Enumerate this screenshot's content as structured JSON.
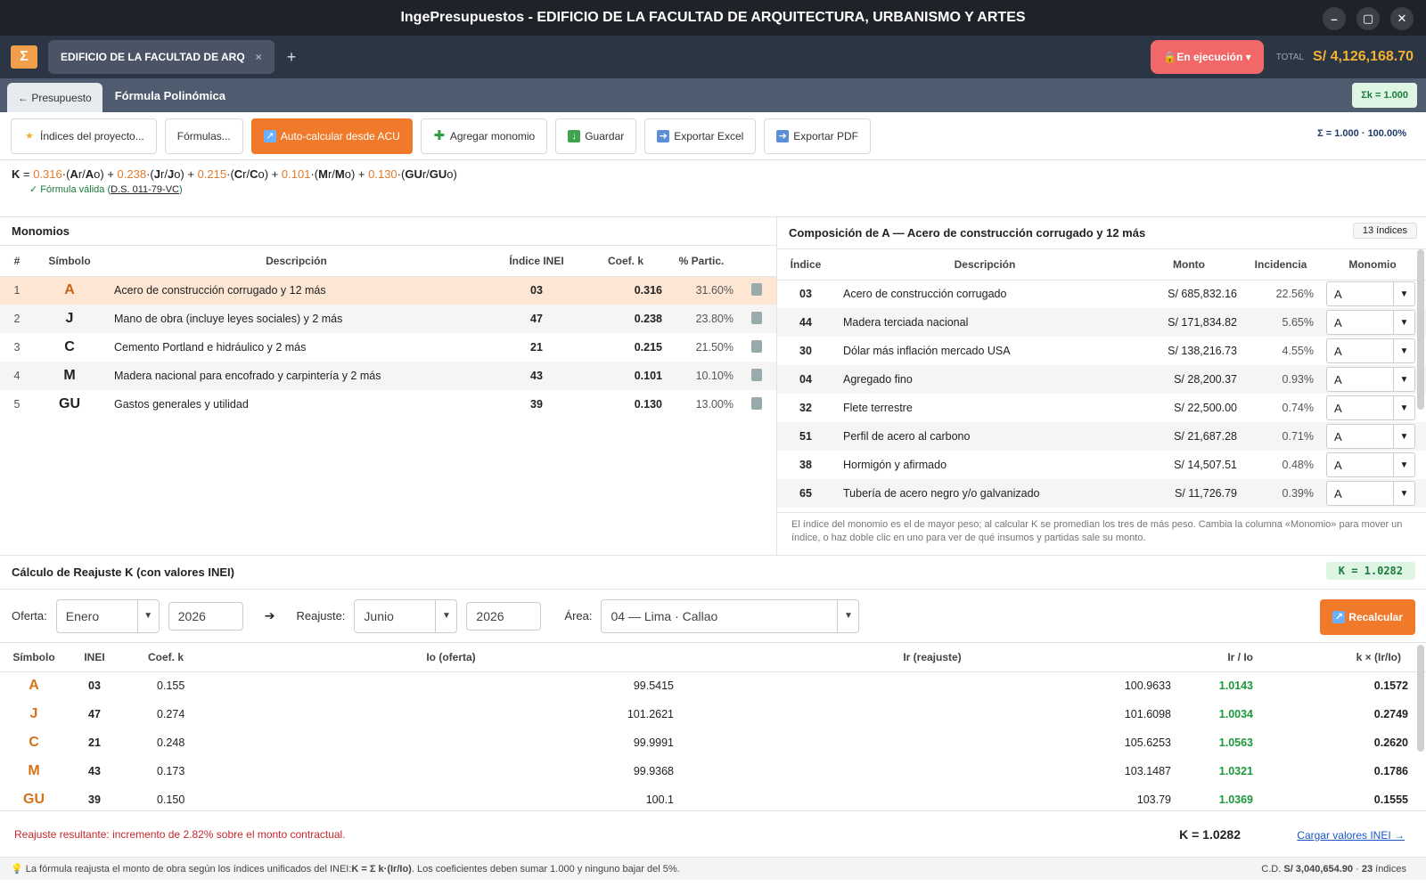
{
  "window": {
    "title": "IngePresupuestos  -  EDIFICIO DE LA FACULTAD DE ARQUITECTURA, URBANISMO Y ARTES"
  },
  "tabbar": {
    "tab_label": "EDIFICIO DE LA FACULTAD DE ARQ",
    "close": "×",
    "add": "+",
    "status": "En ejecución",
    "total_label": "TOTAL",
    "total_value": "S/ 4,126,168.70"
  },
  "subbar": {
    "back": "← Presupuesto",
    "title": "Fórmula Polinómica",
    "sum_k": "Σk = 1.000"
  },
  "toolbar": {
    "indices": "Índices del proyecto...",
    "formulas": "Fórmulas...",
    "autocalc": "Auto-calcular desde ACU",
    "add_monomial": "Agregar monomio",
    "save": "Guardar",
    "excel": "Exportar Excel",
    "pdf": "Exportar PDF",
    "sigma": "Σ = 1.000  ·  100.00%"
  },
  "formula": {
    "k": "K",
    "eq": " = ",
    "terms": [
      {
        "coef": "0.316",
        "sym": "A"
      },
      {
        "coef": "0.238",
        "sym": "J"
      },
      {
        "coef": "0.215",
        "sym": "C"
      },
      {
        "coef": "0.101",
        "sym": "M"
      },
      {
        "coef": "0.130",
        "sym": "GU"
      }
    ],
    "valid": "✓ Fórmula válida (",
    "decree": "D.S. 011-79-VC",
    "valid_end": ")"
  },
  "monomials": {
    "title": "Monomios",
    "headers": [
      "#",
      "Símbolo",
      "Descripción",
      "Índice INEI",
      "Coef. k",
      "% Partic."
    ],
    "rows": [
      {
        "n": "1",
        "sym": "A",
        "desc": "Acero de construcción corrugado y 12 más",
        "idx": "03",
        "k": "0.316",
        "pct": "31.60%"
      },
      {
        "n": "2",
        "sym": "J",
        "desc": "Mano de obra (incluye leyes sociales) y 2 más",
        "idx": "47",
        "k": "0.238",
        "pct": "23.80%"
      },
      {
        "n": "3",
        "sym": "C",
        "desc": "Cemento Portland e hidráulico y 2 más",
        "idx": "21",
        "k": "0.215",
        "pct": "21.50%"
      },
      {
        "n": "4",
        "sym": "M",
        "desc": "Madera nacional para encofrado y carpintería y 2 más",
        "idx": "43",
        "k": "0.101",
        "pct": "10.10%"
      },
      {
        "n": "5",
        "sym": "GU",
        "desc": "Gastos generales y utilidad",
        "idx": "39",
        "k": "0.130",
        "pct": "13.00%"
      }
    ]
  },
  "composition": {
    "title": "Composición de A — Acero de construcción corrugado y 12 más",
    "count": "13 índices",
    "headers": [
      "Índice",
      "Descripción",
      "Monto",
      "Incidencia",
      "Monomio"
    ],
    "rows": [
      {
        "idx": "03",
        "desc": "Acero de construcción corrugado",
        "monto": "S/ 685,832.16",
        "inc": "22.56%",
        "mono": "A"
      },
      {
        "idx": "44",
        "desc": "Madera terciada nacional",
        "monto": "S/ 171,834.82",
        "inc": "5.65%",
        "mono": "A"
      },
      {
        "idx": "30",
        "desc": "Dólar más inflación mercado USA",
        "monto": "S/ 138,216.73",
        "inc": "4.55%",
        "mono": "A"
      },
      {
        "idx": "04",
        "desc": "Agregado fino",
        "monto": "S/ 28,200.37",
        "inc": "0.93%",
        "mono": "A"
      },
      {
        "idx": "32",
        "desc": "Flete terrestre",
        "monto": "S/ 22,500.00",
        "inc": "0.74%",
        "mono": "A"
      },
      {
        "idx": "51",
        "desc": "Perfil de acero al carbono",
        "monto": "S/ 21,687.28",
        "inc": "0.71%",
        "mono": "A"
      },
      {
        "idx": "38",
        "desc": "Hormigón y afirmado",
        "monto": "S/ 14,507.51",
        "inc": "0.48%",
        "mono": "A"
      },
      {
        "idx": "65",
        "desc": "Tubería de acero negro y/o galvanizado",
        "monto": "S/ 11,726.79",
        "inc": "0.39%",
        "mono": "A"
      }
    ],
    "note": "El índice del monomio es el de mayor peso; al calcular K se promedian los tres de más peso. Cambia la columna «Monomio» para mover un índice, o haz doble clic en uno para ver de qué insumos y partidas sale su monto."
  },
  "calc": {
    "title": "Cálculo de Reajuste K (con valores INEI)",
    "k_badge": "K = 1.0282",
    "offer_label": "Oferta:",
    "offer_month": "Enero",
    "offer_year": "2026",
    "arrow": "➔",
    "readj_label": "Reajuste:",
    "readj_month": "Junio",
    "readj_year": "2026",
    "area_label": "Área:",
    "area": "04 — Lima · Callao",
    "recalc": "Recalcular",
    "headers": [
      "Símbolo",
      "INEI",
      "Coef. k",
      "Io (oferta)",
      "Ir (reajuste)",
      "Ir / Io",
      "k × (Ir/Io)"
    ],
    "rows": [
      {
        "sym": "A",
        "inei": "03",
        "k": "0.155",
        "io": "99.5415",
        "ir": "100.9633",
        "ratio": "1.0143",
        "prod": "0.1572"
      },
      {
        "sym": "J",
        "inei": "47",
        "k": "0.274",
        "io": "101.2621",
        "ir": "101.6098",
        "ratio": "1.0034",
        "prod": "0.2749"
      },
      {
        "sym": "C",
        "inei": "21",
        "k": "0.248",
        "io": "99.9991",
        "ir": "105.6253",
        "ratio": "1.0563",
        "prod": "0.2620"
      },
      {
        "sym": "M",
        "inei": "43",
        "k": "0.173",
        "io": "99.9368",
        "ir": "103.1487",
        "ratio": "1.0321",
        "prod": "0.1786"
      },
      {
        "sym": "GU",
        "inei": "39",
        "k": "0.150",
        "io": "100.1",
        "ir": "103.79",
        "ratio": "1.0369",
        "prod": "0.1555"
      }
    ]
  },
  "footer": {
    "result": "Reajuste resultante: incremento de 2.82% sobre el monto contractual.",
    "k": "K = 1.0282",
    "load": "Cargar valores INEI →"
  },
  "statusbar": {
    "hint_a": "La fórmula reajusta el monto de obra según los índices unificados del INEI: ",
    "hint_formula": "K = Σ k·(Ir/Io)",
    "hint_b": ". Los coeficientes deben sumar 1.000 y ninguno bajar del 5%.",
    "cd_label": "C.D. ",
    "cd_value": "S/ 3,040,654.90",
    "indices": "23",
    "indices_label": " índices"
  }
}
